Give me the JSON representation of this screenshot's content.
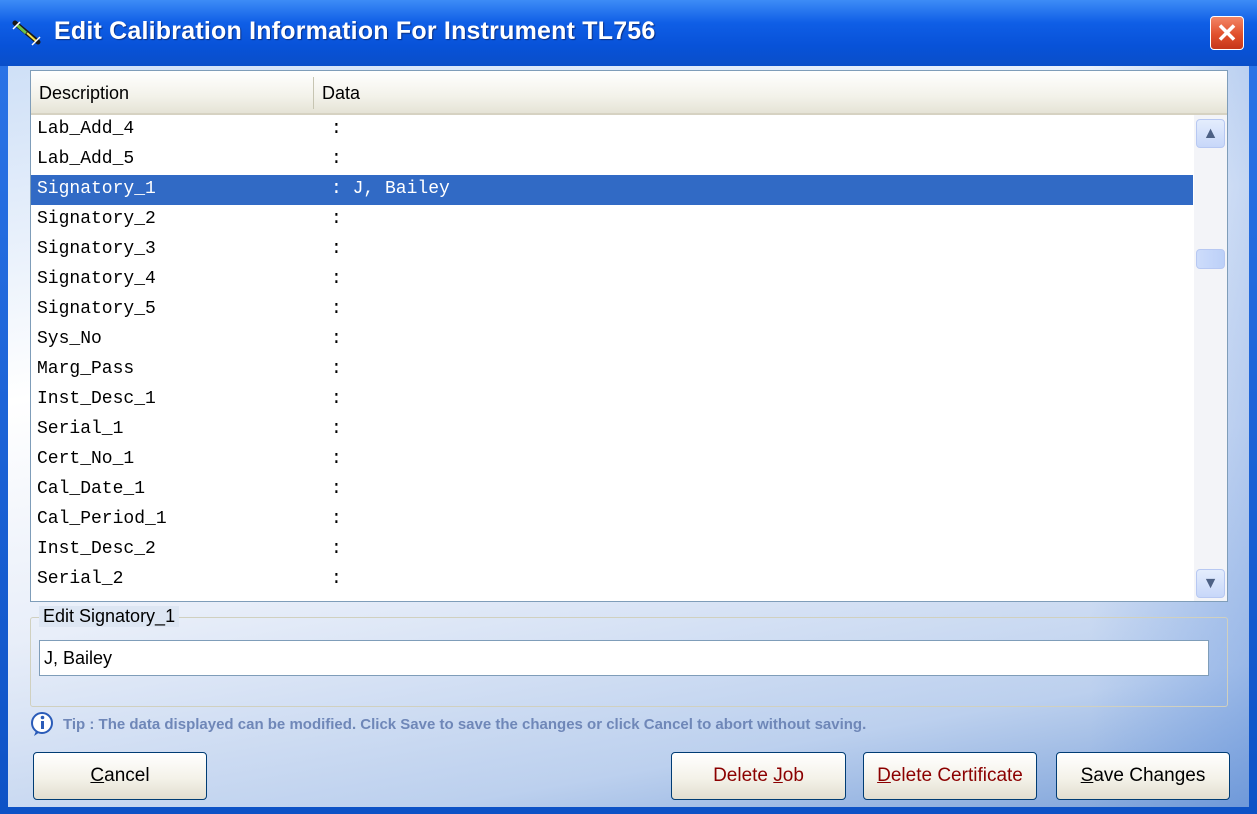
{
  "window": {
    "title": "Edit Calibration Information For Instrument TL756",
    "close_label": "✕"
  },
  "list": {
    "columns": [
      "Description",
      "Data"
    ],
    "rows": [
      {
        "desc": "Lab_Add_4",
        "data": ":",
        "selected": false
      },
      {
        "desc": "Lab_Add_5",
        "data": ":",
        "selected": false
      },
      {
        "desc": "Signatory_1",
        "data": ": J, Bailey",
        "selected": true
      },
      {
        "desc": "Signatory_2",
        "data": ":",
        "selected": false
      },
      {
        "desc": "Signatory_3",
        "data": ":",
        "selected": false
      },
      {
        "desc": "Signatory_4",
        "data": ":",
        "selected": false
      },
      {
        "desc": "Signatory_5",
        "data": ":",
        "selected": false
      },
      {
        "desc": "Sys_No",
        "data": ":",
        "selected": false
      },
      {
        "desc": "Marg_Pass",
        "data": ":",
        "selected": false
      },
      {
        "desc": "Inst_Desc_1",
        "data": ":",
        "selected": false
      },
      {
        "desc": "Serial_1",
        "data": ":",
        "selected": false
      },
      {
        "desc": "Cert_No_1",
        "data": ":",
        "selected": false
      },
      {
        "desc": "Cal_Date_1",
        "data": ":",
        "selected": false
      },
      {
        "desc": "Cal_Period_1",
        "data": ":",
        "selected": false
      },
      {
        "desc": "Inst_Desc_2",
        "data": ":",
        "selected": false
      },
      {
        "desc": "Serial_2",
        "data": ":",
        "selected": false
      }
    ],
    "scroll_up": "▲",
    "scroll_down": "▼"
  },
  "edit_group": {
    "legend": "Edit Signatory_1",
    "value": "J, Bailey"
  },
  "tip": {
    "text": "Tip : The data displayed can be modified. Click Save to save the changes or click Cancel to abort without saving."
  },
  "buttons": {
    "cancel": {
      "pre": "",
      "accel": "C",
      "post": "ancel"
    },
    "delete_job": {
      "pre": "Delete ",
      "accel": "J",
      "post": "ob"
    },
    "delete_certificate": {
      "pre": "",
      "accel": "D",
      "post": "elete Certificate"
    },
    "save_changes": {
      "pre": "",
      "accel": "S",
      "post": "ave Changes"
    }
  },
  "colors": {
    "title_blue": "#0852d8",
    "selection": "#316ac5",
    "close_red": "#e1502c",
    "tip_text": "#6f87b8",
    "danger_text": "#8b0000"
  }
}
